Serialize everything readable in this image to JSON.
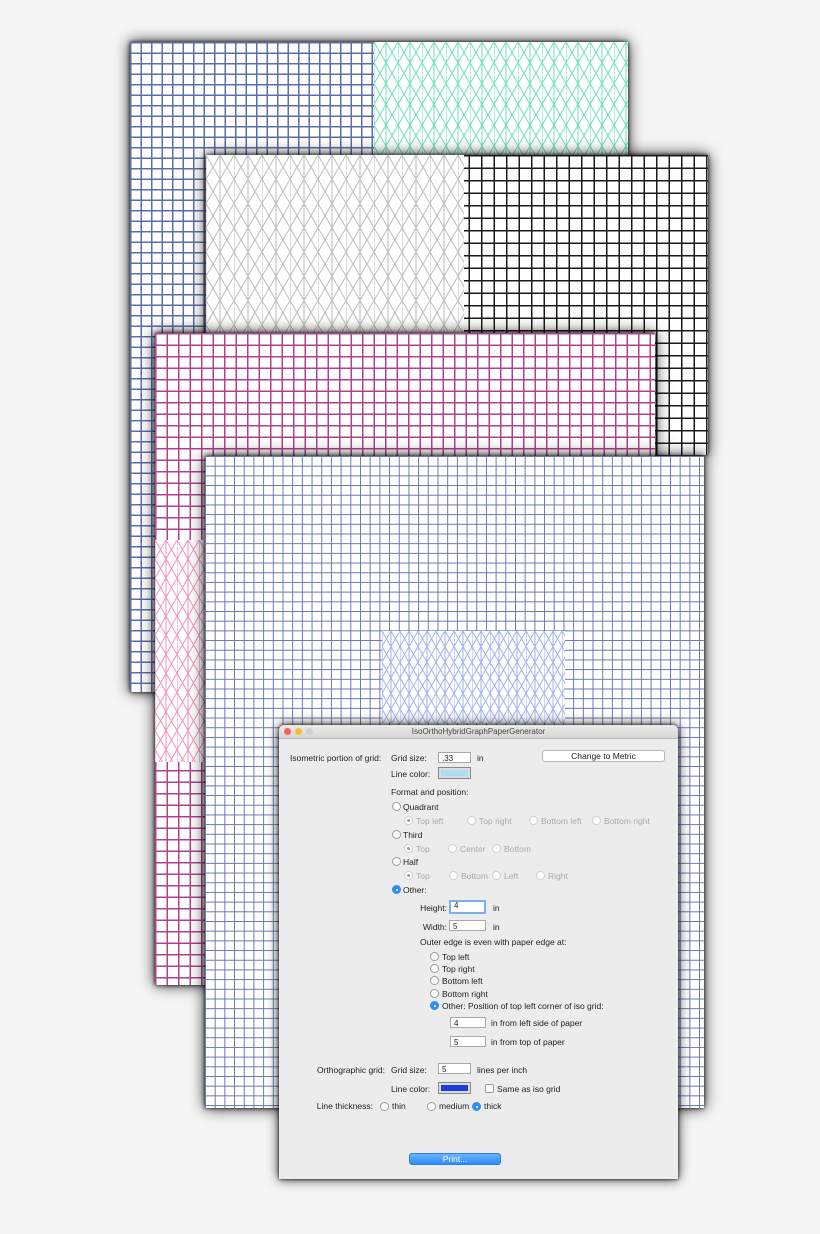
{
  "window": {
    "title": "IsoOrthoHybridGraphPaperGenerator",
    "iso_section_label": "Isometric portion of grid:",
    "grid_size_label": "Grid size:",
    "grid_size_value": ".33",
    "grid_size_unit": "in",
    "metric_button": "Change to Metric",
    "line_color_label": "Line color:",
    "iso_line_color": "#a9dff2",
    "format_label": "Format and position:",
    "quadrant_label": "Quadrant",
    "quadrant_options": [
      "Top left",
      "Top right",
      "Bottom left",
      "Bottom right"
    ],
    "third_label": "Third",
    "third_options": [
      "Top",
      "Center",
      "Bottom"
    ],
    "half_label": "Half",
    "half_options": [
      "Top",
      "Bottom",
      "Left",
      "Right"
    ],
    "other_label": "Other:",
    "height_label": "Height:",
    "height_value": "4",
    "height_unit": "in",
    "width_label": "Width:",
    "width_value": "5",
    "width_unit": "in",
    "outer_edge_label": "Outer edge is even with paper edge at:",
    "edge_options": [
      "Top left",
      "Top right",
      "Bottom left",
      "Bottom right"
    ],
    "edge_other_label": "Other: Position of top left corner of iso grid:",
    "left_value": "4",
    "left_label": "in from left side of paper",
    "top_value": "5",
    "top_label": "in from top of paper",
    "ortho_section_label": "Orthographic grid:",
    "ortho_grid_size_value": "5",
    "ortho_grid_size_unit": "lines per inch",
    "ortho_line_color": "#1b3ed8",
    "same_as_iso_label": "Same as iso grid",
    "thickness_label": "Line thickness:",
    "thickness_options": [
      "thin",
      "medium",
      "thick"
    ],
    "print_button": "Print..."
  },
  "colors": {
    "sheet1_square": "#5a6fa8",
    "sheet1_iso": "#6ee0b6",
    "sheet2_iso": "#bdbdbd",
    "sheet2_square": "#1a1a1a",
    "sheet3_square": "#b0428a",
    "sheet3_iso": "#ef93b8",
    "sheet4_square": "#6678ad",
    "sheet4_iso": "#9fb3ef"
  }
}
